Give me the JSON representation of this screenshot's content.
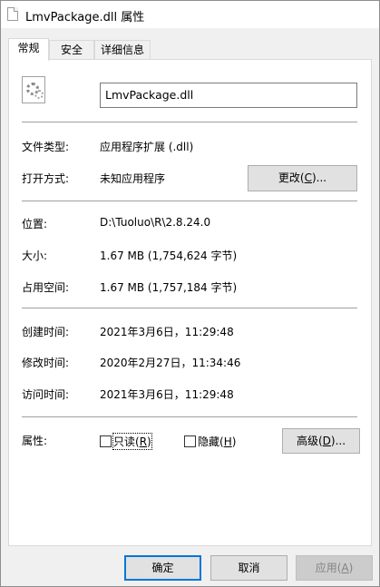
{
  "window": {
    "title": "LmvPackage.dll 属性",
    "file_icon": "dll-file-icon"
  },
  "tabs": [
    {
      "label": "常规",
      "active": true
    },
    {
      "label": "安全",
      "active": false
    },
    {
      "label": "详细信息",
      "active": false
    }
  ],
  "general": {
    "file_name": "LmvPackage.dll",
    "file_type_label": "文件类型:",
    "file_type_value": "应用程序扩展 (.dll)",
    "open_with_label": "打开方式:",
    "open_with_value": "未知应用程序",
    "change_button": {
      "text": "更改(",
      "key": "C",
      "suffix": ")..."
    },
    "location_label": "位置:",
    "location_value": "D:\\Tuoluo\\R\\2.8.24.0",
    "size_label": "大小:",
    "size_value": "1.67 MB (1,754,624 字节)",
    "size_on_disk_label": "占用空间:",
    "size_on_disk_value": "1.67 MB (1,757,184 字节)",
    "created_label": "创建时间:",
    "created_value": "2021年3月6日，11:29:48",
    "modified_label": "修改时间:",
    "modified_value": "2020年2月27日，11:34:46",
    "accessed_label": "访问时间:",
    "accessed_value": "2021年3月6日，11:29:48",
    "attributes_label": "属性:",
    "readonly": {
      "text": "只读(",
      "key": "R",
      "suffix": ")",
      "checked": false
    },
    "hidden": {
      "text": "隐藏(",
      "key": "H",
      "suffix": ")",
      "checked": false
    },
    "advanced_button": {
      "text": "高级(",
      "key": "D",
      "suffix": ")..."
    }
  },
  "footer": {
    "ok": "确定",
    "cancel": "取消",
    "apply": {
      "text": "应用(",
      "key": "A",
      "suffix": ")",
      "enabled": false
    }
  }
}
